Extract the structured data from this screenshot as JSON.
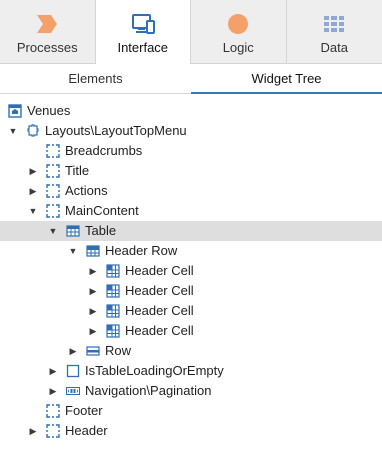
{
  "main_tabs": [
    {
      "label": "Processes",
      "icon": "processes-icon",
      "active": false,
      "color": "#f4a06a"
    },
    {
      "label": "Interface",
      "icon": "interface-icon",
      "active": true,
      "color": "#2f6fb5"
    },
    {
      "label": "Logic",
      "icon": "logic-icon",
      "active": false,
      "color": "#f4a06a"
    },
    {
      "label": "Data",
      "icon": "data-icon",
      "active": false,
      "color": "#8fa8d6"
    }
  ],
  "sub_tabs": [
    {
      "label": "Elements",
      "active": false
    },
    {
      "label": "Widget Tree",
      "active": true
    }
  ],
  "accent_color": "#2f7cc1",
  "tree": [
    {
      "label": "Venues",
      "icon": "screen-icon",
      "depth": 0,
      "toggle": "none",
      "selected": false
    },
    {
      "label": "Layouts\\LayoutTopMenu",
      "icon": "block-icon",
      "depth": 1,
      "toggle": "expanded",
      "selected": false
    },
    {
      "label": "Breadcrumbs",
      "icon": "placeholder-icon",
      "depth": 2,
      "toggle": "none",
      "selected": false
    },
    {
      "label": "Title",
      "icon": "placeholder-icon",
      "depth": 2,
      "toggle": "collapsed",
      "selected": false
    },
    {
      "label": "Actions",
      "icon": "placeholder-icon",
      "depth": 2,
      "toggle": "collapsed",
      "selected": false
    },
    {
      "label": "MainContent",
      "icon": "placeholder-icon",
      "depth": 2,
      "toggle": "expanded",
      "selected": false
    },
    {
      "label": "Table",
      "icon": "table-icon",
      "depth": 3,
      "toggle": "expanded",
      "selected": true
    },
    {
      "label": "Header Row",
      "icon": "header-row-icon",
      "depth": 4,
      "toggle": "expanded",
      "selected": false
    },
    {
      "label": "Header Cell",
      "icon": "header-cell-icon",
      "depth": 5,
      "toggle": "collapsed",
      "selected": false
    },
    {
      "label": "Header Cell",
      "icon": "header-cell-icon",
      "depth": 5,
      "toggle": "collapsed",
      "selected": false
    },
    {
      "label": "Header Cell",
      "icon": "header-cell-icon",
      "depth": 5,
      "toggle": "collapsed",
      "selected": false
    },
    {
      "label": "Header Cell",
      "icon": "header-cell-icon",
      "depth": 5,
      "toggle": "collapsed",
      "selected": false
    },
    {
      "label": "Row",
      "icon": "row-icon",
      "depth": 4,
      "toggle": "collapsed",
      "selected": false
    },
    {
      "label": "IsTableLoadingOrEmpty",
      "icon": "if-icon",
      "depth": 3,
      "toggle": "collapsed",
      "selected": false
    },
    {
      "label": "Navigation\\Pagination",
      "icon": "pagination-icon",
      "depth": 3,
      "toggle": "collapsed",
      "selected": false
    },
    {
      "label": "Footer",
      "icon": "placeholder-icon",
      "depth": 2,
      "toggle": "none",
      "selected": false
    },
    {
      "label": "Header",
      "icon": "placeholder-icon",
      "depth": 2,
      "toggle": "collapsed",
      "selected": false
    }
  ]
}
